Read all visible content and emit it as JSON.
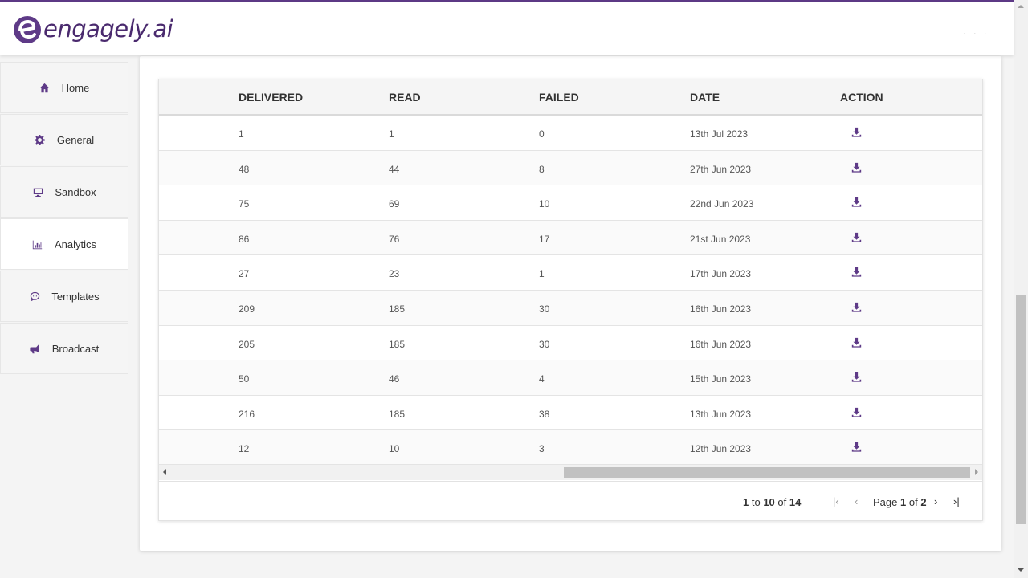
{
  "app": {
    "logo_text": "engagely.ai"
  },
  "sidebar": {
    "items": [
      {
        "label": "Home",
        "icon": "home-icon",
        "active": false
      },
      {
        "label": "General",
        "icon": "gear-icon",
        "active": false
      },
      {
        "label": "Sandbox",
        "icon": "monitor-icon",
        "active": false
      },
      {
        "label": "Analytics",
        "icon": "bar-chart-icon",
        "active": true
      },
      {
        "label": "Templates",
        "icon": "chat-bubble-icon",
        "active": false
      },
      {
        "label": "Broadcast",
        "icon": "megaphone-icon",
        "active": false
      }
    ]
  },
  "table": {
    "columns": [
      "DELIVERED",
      "READ",
      "FAILED",
      "DATE",
      "ACTION"
    ],
    "rows": [
      [
        "1",
        "1",
        "0",
        "13th Jul 2023"
      ],
      [
        "48",
        "44",
        "8",
        "27th Jun 2023"
      ],
      [
        "75",
        "69",
        "10",
        "22nd Jun 2023"
      ],
      [
        "86",
        "76",
        "17",
        "21st Jun 2023"
      ],
      [
        "27",
        "23",
        "1",
        "17th Jun 2023"
      ],
      [
        "209",
        "185",
        "30",
        "16th Jun 2023"
      ],
      [
        "205",
        "185",
        "30",
        "16th Jun 2023"
      ],
      [
        "50",
        "46",
        "4",
        "15th Jun 2023"
      ],
      [
        "216",
        "185",
        "38",
        "13th Jun 2023"
      ],
      [
        "12",
        "10",
        "3",
        "12th Jun 2023"
      ]
    ],
    "action_icon": "download-icon"
  },
  "pagination": {
    "from": "1",
    "to_word": "to",
    "to": "10",
    "of_word": "of",
    "total": "14",
    "page_word": "Page",
    "page": "1",
    "page_of_word": "of",
    "pages": "2"
  },
  "colors": {
    "accent": "#5e3a87",
    "header_bg": "#ffffff",
    "page_bg": "#f4f4f4"
  }
}
